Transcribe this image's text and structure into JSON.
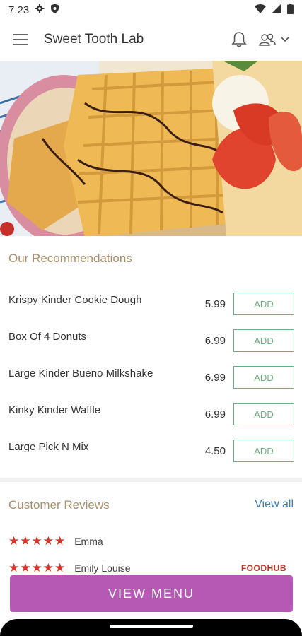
{
  "status": {
    "time": "7:23"
  },
  "appbar": {
    "title": "Sweet Tooth Lab"
  },
  "recommendations": {
    "title": "Our Recommendations",
    "add_label": "ADD",
    "items": [
      {
        "name": "Krispy Kinder Cookie Dough",
        "price": "5.99"
      },
      {
        "name": "Box Of 4 Donuts",
        "price": "6.99"
      },
      {
        "name": "Large Kinder Bueno Milkshake",
        "price": "6.99"
      },
      {
        "name": "Kinky Kinder Waffle",
        "price": "6.99"
      },
      {
        "name": "Large Pick N Mix",
        "price": "4.50"
      }
    ]
  },
  "reviews": {
    "title": "Customer Reviews",
    "view_all": "View all",
    "entries": [
      {
        "stars": "★★★★★",
        "name": "Emma"
      },
      {
        "stars": "★★★★★",
        "name": "Emily Louise",
        "source": "FOODHUB"
      }
    ]
  },
  "cta": {
    "label": "VIEW MENU"
  },
  "colors": {
    "accent": "#b559b5",
    "add_border": "#6fae82",
    "section_title": "#a9906a",
    "link": "#3d7fb4",
    "stars": "#d9342b"
  },
  "icons": [
    "menu-icon",
    "bell-icon",
    "profile-icon",
    "chevron-down-icon",
    "settings-icon",
    "shield-icon",
    "wifi-icon",
    "signal-icon",
    "battery-icon"
  ]
}
